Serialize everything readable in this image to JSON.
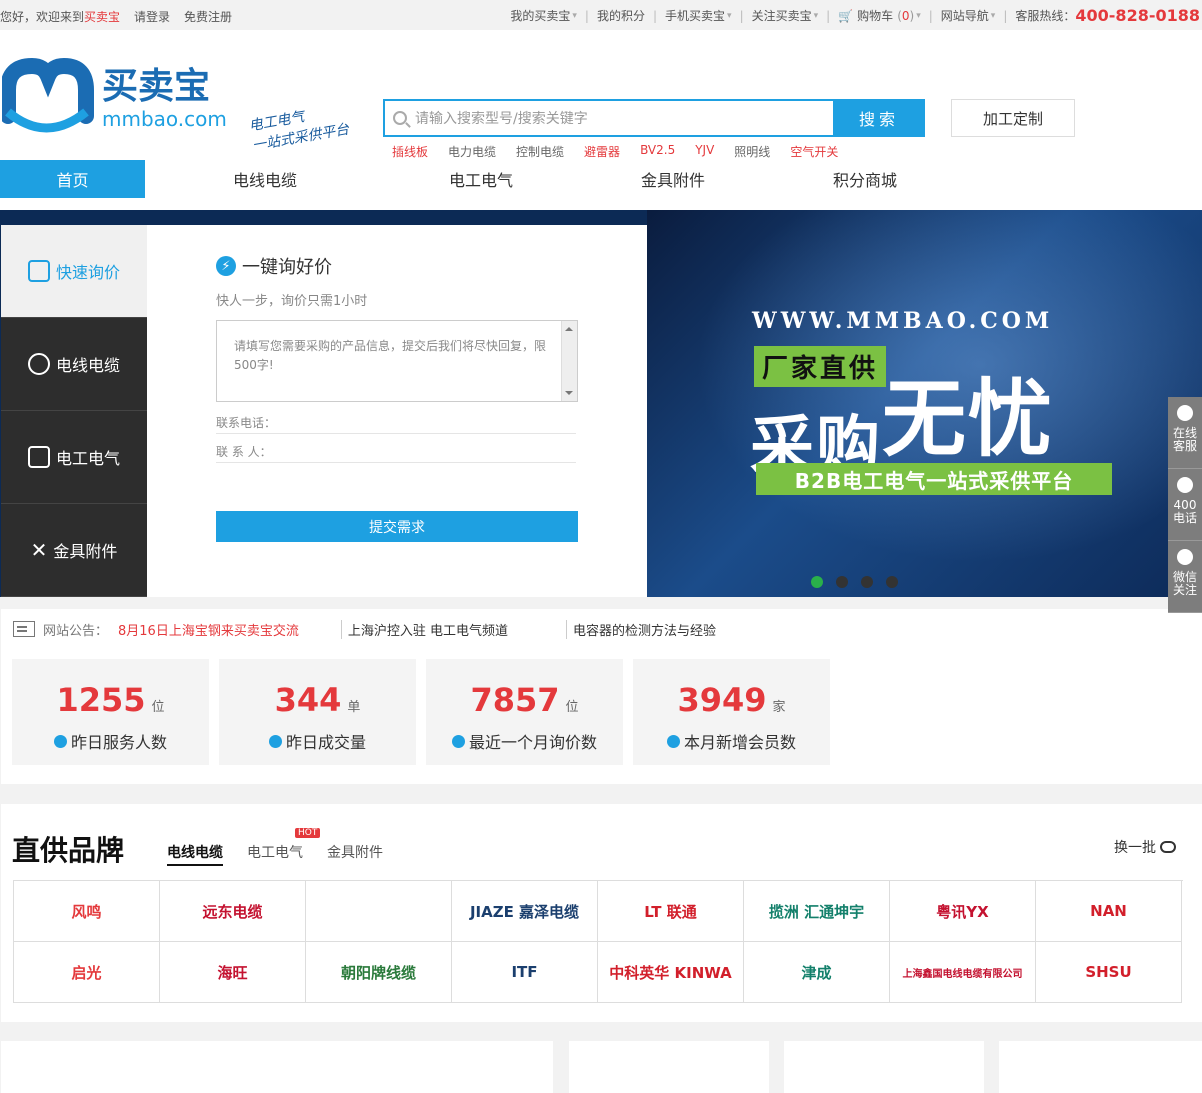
{
  "topbar": {
    "welcome": "您好，欢迎来到",
    "site_name": "买卖宝",
    "login": "请登录",
    "register": "免费注册",
    "links": [
      "我的买卖宝",
      "我的积分",
      "手机买卖宝",
      "关注买卖宝"
    ],
    "cart_label": "购物车",
    "cart_count_open": "(",
    "cart_count": "0",
    "cart_count_close": ")",
    "site_nav": "网站导航",
    "hotline_label": "客服热线：",
    "hotline": "400-828-0188"
  },
  "header": {
    "logo_cn": "买卖宝",
    "logo_en": "mmbao.com",
    "slogan_1": "电工电气",
    "slogan_2": "一站式采供平台",
    "search_placeholder": "请输入搜索型号/搜索关键字",
    "search_button": "搜索",
    "custom_button": "加工定制",
    "hotwords": [
      {
        "text": "插线板",
        "red": true
      },
      {
        "text": "电力电缆",
        "red": false
      },
      {
        "text": "控制电缆",
        "red": false
      },
      {
        "text": "避雷器",
        "red": true
      },
      {
        "text": "BV2.5",
        "red": true
      },
      {
        "text": "YJV",
        "red": true
      },
      {
        "text": "照明线",
        "red": false
      },
      {
        "text": "空气开关",
        "red": true
      }
    ]
  },
  "nav": [
    "首页",
    "电线电缆",
    "电工电气",
    "金具附件",
    "积分商城"
  ],
  "banner": {
    "side_tabs": [
      "快速询价",
      "电线电缆",
      "电工电气",
      "金具附件"
    ],
    "inquiry_title": "一键询好价",
    "inquiry_sub": "快人一步，询价只需1小时",
    "textarea_placeholder": "请填写您需要采购的产品信息，提交后我们将尽快回复，限500字!",
    "phone_label": "联系电话：",
    "contact_label": "联 系 人：",
    "submit": "提交需求",
    "url": "WWW.MMBAO.COM",
    "tag": "厂家直供",
    "headline_1": "采购",
    "headline_2": "无忧",
    "subline": "B2B电工电气一站式采供平台",
    "active_dot": 0
  },
  "float": [
    "在线客服",
    "400电话",
    "微信关注"
  ],
  "notice": {
    "label": "网站公告：",
    "items": [
      "8月16日上海宝钢来买卖宝交流",
      "上海沪控入驻 电工电气频道",
      "电容器的检测方法与经验"
    ]
  },
  "stats": [
    {
      "value": "1255",
      "unit": "位",
      "label": "昨日服务人数"
    },
    {
      "value": "344",
      "unit": "单",
      "label": "昨日成交量"
    },
    {
      "value": "7857",
      "unit": "位",
      "label": "最近一个月询价数"
    },
    {
      "value": "3949",
      "unit": "家",
      "label": "本月新增会员数"
    }
  ],
  "brands": {
    "title": "直供品牌",
    "tabs": [
      "电线电缆",
      "电工电气",
      "金具附件"
    ],
    "hot_badge": "HOT",
    "swap": "换一批",
    "row1": [
      "风鸣",
      "远东电缆",
      "",
      "JIAZE 嘉泽电缆",
      "LT 联通",
      "揽洲 汇通坤宇",
      "粤讯YX",
      "NAN"
    ],
    "row2": [
      "启光",
      "海旺",
      "朝阳牌线缆",
      "ITF",
      "中科英华 KINWA",
      "津成",
      "上海鑫国电线电缆有限公司",
      "SHSU"
    ]
  },
  "colors": {
    "accent": "#1ea0e1",
    "red": "#e4393c",
    "green": "#7bc143"
  }
}
